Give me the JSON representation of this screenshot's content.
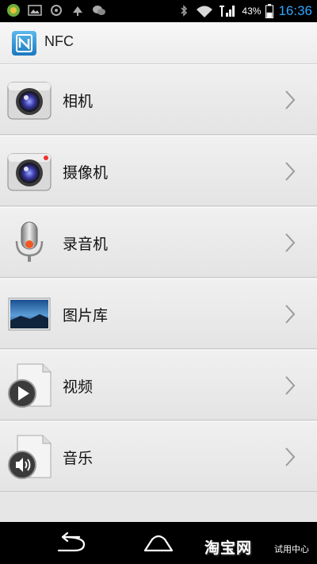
{
  "status_bar": {
    "battery_percent": "43%",
    "time": "16:36",
    "left_icons": [
      "app-notification-icon",
      "image-icon",
      "circle-icon",
      "usb-debug-icon",
      "wechat-icon"
    ],
    "right_icons": [
      "bluetooth-icon",
      "wifi-icon",
      "signal-icon",
      "battery-icon"
    ],
    "battery_level": 0.43
  },
  "title_bar": {
    "title": "NFC",
    "icon": "nfc-icon"
  },
  "list": {
    "items": [
      {
        "label": "相机",
        "icon": "camera-icon"
      },
      {
        "label": "摄像机",
        "icon": "video-camera-icon"
      },
      {
        "label": "录音机",
        "icon": "microphone-icon"
      },
      {
        "label": "图片库",
        "icon": "gallery-icon"
      },
      {
        "label": "视频",
        "icon": "video-file-icon"
      },
      {
        "label": "音乐",
        "icon": "music-file-icon"
      }
    ]
  },
  "nav_bar": {
    "buttons": [
      "back-icon",
      "home-icon"
    ]
  },
  "watermark": {
    "text": "淘宝网",
    "subtext": "试用中心"
  }
}
